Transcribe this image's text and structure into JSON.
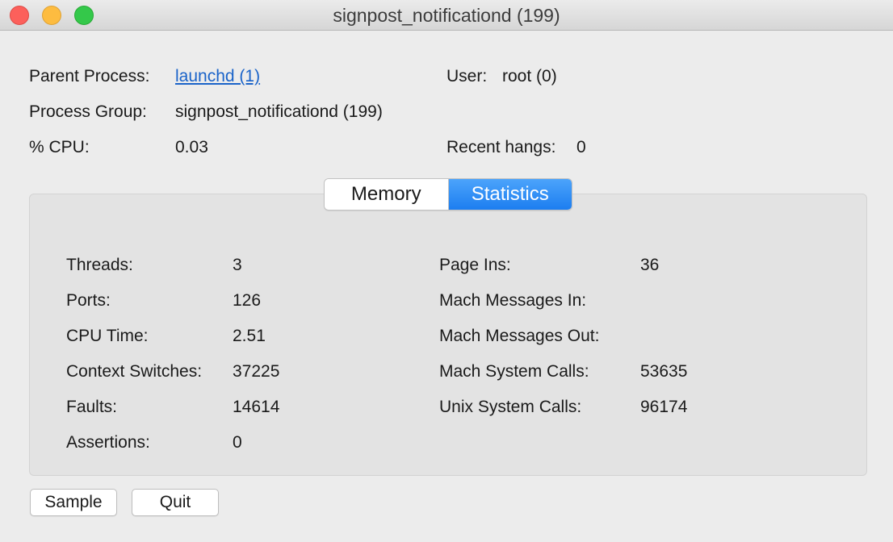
{
  "window": {
    "title": "signpost_notificationd (199)"
  },
  "info": {
    "parent_process_label": "Parent Process:",
    "parent_process_value": "launchd (1)",
    "user_label": "User:",
    "user_value": "root (0)",
    "process_group_label": "Process Group:",
    "process_group_value": "signpost_notificationd (199)",
    "cpu_label": "% CPU:",
    "cpu_value": "0.03",
    "recent_hangs_label": "Recent hangs:",
    "recent_hangs_value": "0"
  },
  "tabs": {
    "memory": "Memory",
    "statistics": "Statistics",
    "active": "statistics",
    "active_color": "#1c7ef0"
  },
  "stats": {
    "left": [
      {
        "label": "Threads:",
        "value": "3"
      },
      {
        "label": "Ports:",
        "value": "126"
      },
      {
        "label": "CPU Time:",
        "value": "2.51"
      },
      {
        "label": "Context Switches:",
        "value": "37225"
      },
      {
        "label": "Faults:",
        "value": "14614"
      },
      {
        "label": "Assertions:",
        "value": "0"
      }
    ],
    "right": [
      {
        "label": "Page Ins:",
        "value": "36"
      },
      {
        "label": "Mach Messages In:",
        "value": ""
      },
      {
        "label": "Mach Messages Out:",
        "value": ""
      },
      {
        "label": "Mach System Calls:",
        "value": "53635"
      },
      {
        "label": "Unix System Calls:",
        "value": "96174"
      }
    ]
  },
  "buttons": {
    "sample": "Sample",
    "quit": "Quit"
  }
}
